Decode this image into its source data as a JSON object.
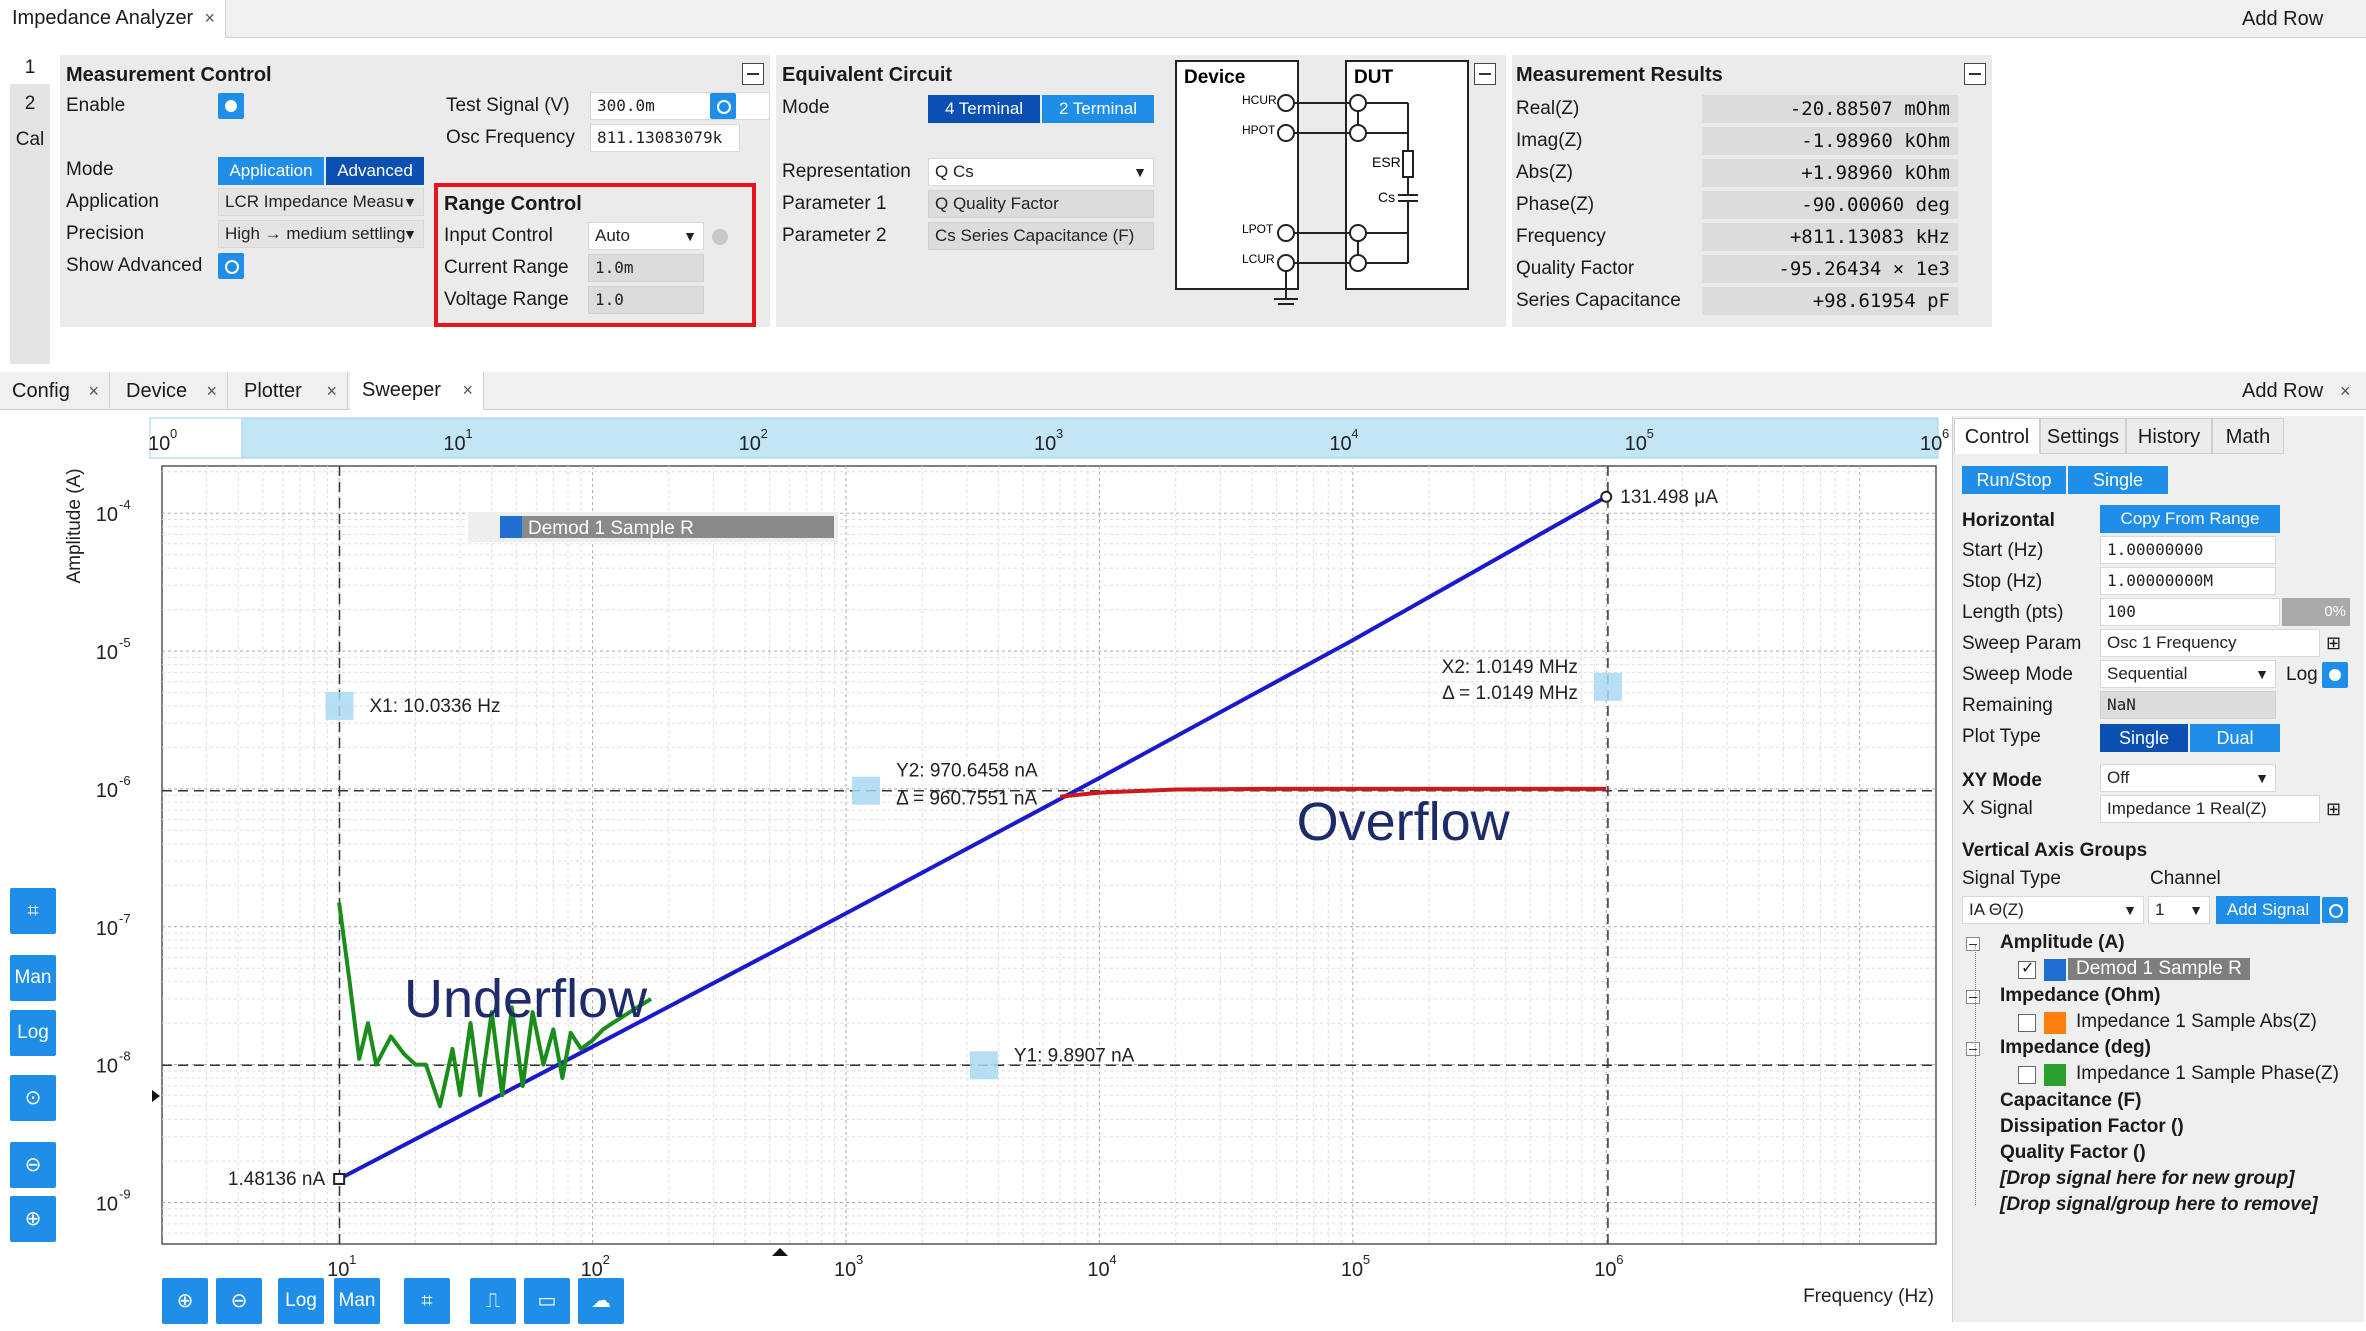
{
  "top_tabs": {
    "tab1": "Impedance Analyzer",
    "add_row": "Add Row"
  },
  "side_tabs": [
    "1",
    "2",
    "Cal"
  ],
  "measurement_control": {
    "title": "Measurement Control",
    "enable_label": "Enable",
    "test_signal_label": "Test Signal (V)",
    "test_signal_value": "300.0m",
    "osc_freq_label": "Osc Frequency",
    "osc_freq_value": "811.13083079k",
    "mode_label": "Mode",
    "mode_application": "Application",
    "mode_advanced": "Advanced",
    "application_label": "Application",
    "application_value": "LCR Impedance Measu",
    "precision_label": "Precision",
    "precision_value": "High → medium settling",
    "show_advanced_label": "Show Advanced"
  },
  "range_control": {
    "title": "Range Control",
    "input_control_label": "Input Control",
    "input_control_value": "Auto",
    "current_range_label": "Current Range",
    "current_range_value": "1.0m",
    "voltage_range_label": "Voltage Range",
    "voltage_range_value": "1.0"
  },
  "equivalent_circuit": {
    "title": "Equivalent Circuit",
    "mode_label": "Mode",
    "mode_4t": "4 Terminal",
    "mode_2t": "2 Terminal",
    "representation_label": "Representation",
    "representation_value": "Q Cs",
    "param1_label": "Parameter 1",
    "param1_value": "Q Quality Factor",
    "param2_label": "Parameter 2",
    "param2_value": "Cs Series Capacitance (F)"
  },
  "circuit_diagram": {
    "device": "Device",
    "dut": "DUT",
    "hcur": "HCUR",
    "hpot": "HPOT",
    "lpot": "LPOT",
    "lcur": "LCUR",
    "esr": "ESR",
    "cs": "Cs"
  },
  "measurement_results": {
    "title": "Measurement Results",
    "rows": [
      {
        "label": "Real(Z)",
        "value": "-20.88507 mOhm"
      },
      {
        "label": "Imag(Z)",
        "value": "-1.98960 kOhm"
      },
      {
        "label": "Abs(Z)",
        "value": "+1.98960 kOhm"
      },
      {
        "label": "Phase(Z)",
        "value": "-90.00060  deg"
      },
      {
        "label": "Frequency",
        "value": "+811.13083 kHz"
      },
      {
        "label": "Quality Factor",
        "value": "-95.26434 × 1e3"
      },
      {
        "label": "Series Capacitance",
        "value": "+98.61954 pF"
      }
    ]
  },
  "bottom_tabs": {
    "config": "Config",
    "device": "Device",
    "plotter": "Plotter",
    "sweeper": "Sweeper",
    "add_row": "Add Row"
  },
  "plot": {
    "ylabel": "Amplitude (A)",
    "xlabel": "Frequency (Hz)",
    "legend": "Demod 1 Sample R",
    "underflow": "Underflow",
    "overflow": "Overflow",
    "cursor_x1": "X1: 10.0336 Hz",
    "cursor_x2_line1": "X2: 1.0149 MHz",
    "cursor_x2_line2": "Δ = 1.0149 MHz",
    "cursor_y2_line1": "Y2: 970.6458 nA",
    "cursor_y2_line2": "Δ = 960.7551 nA",
    "cursor_y1": "Y1: 9.8907 nA",
    "end_label": "131.498 μA",
    "start_label": "1.48136 nA",
    "toolbar_side": [
      "Man",
      "Log"
    ],
    "toolbar_bottom": [
      "Log",
      "Man"
    ]
  },
  "chart_data": {
    "type": "line",
    "xlabel": "Frequency (Hz)",
    "ylabel": "Amplitude (A)",
    "x_scale": "log",
    "y_scale": "log",
    "xlim": [
      2,
      20000000
    ],
    "ylim": [
      5e-10,
      0.00022
    ],
    "x_ticks": [
      "10^1",
      "10^2",
      "10^3",
      "10^4",
      "10^5",
      "10^6"
    ],
    "y_ticks": [
      "10^-9",
      "10^-8",
      "10^-7",
      "10^-6",
      "10^-5",
      "10^-4"
    ],
    "overview_ticks": [
      "10^0",
      "10^1",
      "10^2",
      "10^3",
      "10^4",
      "10^5",
      "10^6"
    ],
    "grid": true,
    "legend_position": "top-left",
    "series": [
      {
        "name": "Demod 1 Sample R",
        "color": "#1a1acc",
        "x": [
          10,
          100,
          1000,
          10000,
          100000,
          1000000
        ],
        "y": [
          1.48136e-09,
          1.35e-08,
          1.25e-07,
          1.2e-06,
          1.2e-05,
          0.000131498
        ]
      },
      {
        "color": "#1a8c1a",
        "x": [
          10,
          11,
          12,
          13,
          14,
          16,
          18,
          20,
          22,
          25,
          28,
          30,
          33,
          36,
          40,
          44,
          48,
          53,
          58,
          64,
          70,
          76,
          82,
          90,
          100,
          110,
          120,
          135,
          150,
          170
        ],
        "y": [
          1.5e-07,
          4e-08,
          1.1e-08,
          2e-08,
          1e-08,
          1.6e-08,
          1.2e-08,
          1e-08,
          1e-08,
          5e-09,
          1.3e-08,
          6e-09,
          2e-08,
          6e-09,
          2.4e-08,
          6e-09,
          2.6e-08,
          7e-09,
          2.4e-08,
          1e-08,
          1.8e-08,
          8e-09,
          1.7e-08,
          1.3e-08,
          1.5e-08,
          1.8e-08,
          2e-08,
          2.3e-08,
          2.6e-08,
          3e-08
        ]
      },
      {
        "color": "#cc1a1a",
        "x": [
          7000,
          10000,
          20000,
          50000,
          100000,
          300000,
          1000000
        ],
        "y": [
          8.8e-07,
          9.4e-07,
          9.9e-07,
          1e-06,
          1e-06,
          1e-06,
          1e-06
        ]
      }
    ],
    "cursors": {
      "x1": 10.0336,
      "x2": 1014900,
      "y1": 9.8907e-09,
      "y2": 9.706458e-07
    }
  },
  "control_panel": {
    "tabs": [
      "Control",
      "Settings",
      "History",
      "Math"
    ],
    "run_stop": "Run/Stop",
    "single": "Single",
    "horizontal": "Horizontal",
    "copy_from_range": "Copy From Range",
    "start_label": "Start (Hz)",
    "start_value": "1.00000000",
    "stop_label": "Stop (Hz)",
    "stop_value": "1.00000000M",
    "length_label": "Length (pts)",
    "length_value": "100",
    "progress": "0%",
    "sweep_param_label": "Sweep Param",
    "sweep_param_value": "Osc 1 Frequency",
    "sweep_mode_label": "Sweep Mode",
    "sweep_mode_value": "Sequential",
    "log_label": "Log",
    "remaining_label": "Remaining",
    "remaining_value": "NaN",
    "plot_type_label": "Plot Type",
    "plot_single": "Single",
    "plot_dual": "Dual",
    "xy_mode_label": "XY Mode",
    "xy_mode_value": "Off",
    "x_signal_label": "X Signal",
    "x_signal_value": "Impedance 1 Real(Z)",
    "vag_title": "Vertical Axis Groups",
    "signal_type_label": "Signal Type",
    "channel_label": "Channel",
    "signal_type_value": "IA Θ(Z)",
    "channel_value": "1",
    "add_signal": "Add Signal",
    "groups": [
      {
        "name": "Amplitude (A)"
      },
      {
        "item": "Demod 1 Sample R"
      },
      {
        "name": "Impedance (Ohm)"
      },
      {
        "item": "Impedance 1 Sample Abs(Z)"
      },
      {
        "name": "Impedance (deg)"
      },
      {
        "item": "Impedance 1 Sample Phase(Z)"
      },
      {
        "name": "Capacitance (F)"
      },
      {
        "name": "Dissipation Factor ()"
      },
      {
        "name": "Quality Factor ()"
      },
      {
        "drop1": "[Drop signal here for new group]"
      },
      {
        "drop2": "[Drop signal/group here to remove]"
      }
    ]
  }
}
